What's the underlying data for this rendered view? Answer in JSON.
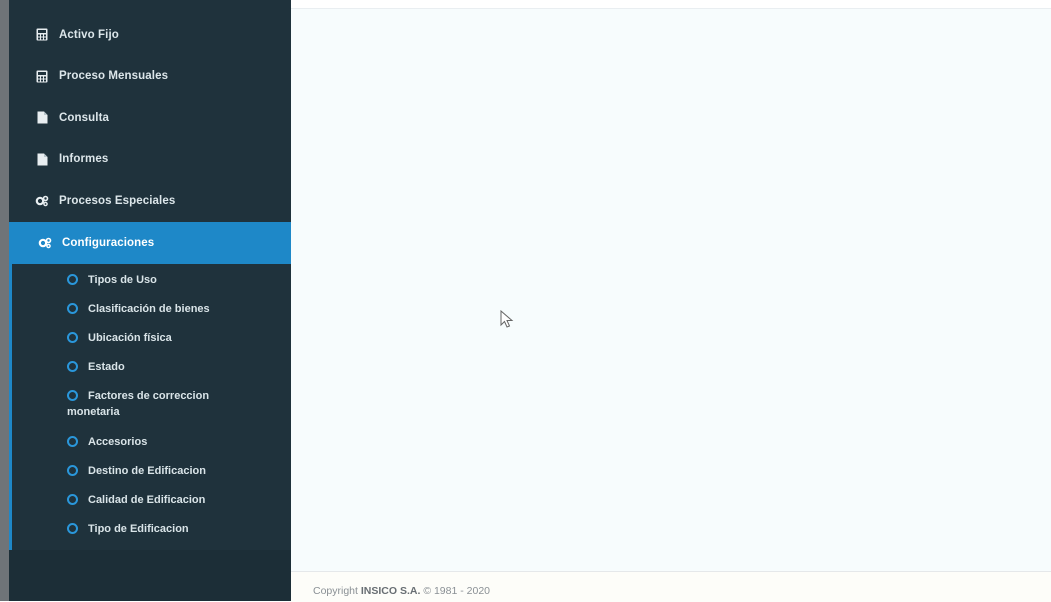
{
  "sidebar": {
    "items": [
      {
        "label": "Activo Fijo",
        "icon": "calculator-icon"
      },
      {
        "label": "Proceso Mensuales",
        "icon": "calculator-icon"
      },
      {
        "label": "Consulta",
        "icon": "file-icon"
      },
      {
        "label": "Informes",
        "icon": "file-icon"
      },
      {
        "label": "Procesos Especiales",
        "icon": "gears-icon"
      },
      {
        "label": "Configuraciones",
        "icon": "gears-icon",
        "active": true
      }
    ],
    "submenu": [
      {
        "label": "Tipos de Uso"
      },
      {
        "label": "Clasificación de bienes"
      },
      {
        "label": "Ubicación física"
      },
      {
        "label": "Estado"
      },
      {
        "label": "Factores de correccion monetaria"
      },
      {
        "label": "Accesorios"
      },
      {
        "label": "Destino de Edificacion"
      },
      {
        "label": "Calidad de Edificacion"
      },
      {
        "label": "Tipo de Edificacion"
      }
    ]
  },
  "footer": {
    "prefix": "Copyright",
    "company": "INSICO S.A.",
    "suffix": "© 1981 - 2020"
  },
  "colors": {
    "sidebar_bg": "#1f323c",
    "active_bg": "#1e88c8",
    "bullet": "#2a97db"
  }
}
